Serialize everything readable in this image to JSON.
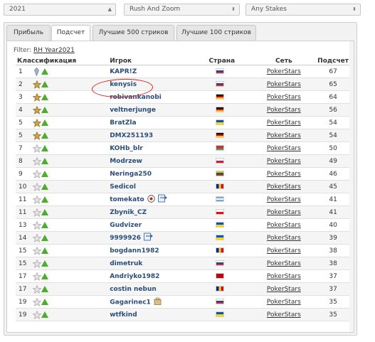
{
  "filters": {
    "year": "2021",
    "game": "Rush And Zoom",
    "stakes": "Any Stakes"
  },
  "tabs": [
    "Прибыль",
    "Подсчет",
    "Лучшие 500 стриков",
    "Лучшие 100 стриков"
  ],
  "active_tab": "Подсчет",
  "filter_label": "Filter:",
  "filter_value": "RH Year2021",
  "columns": {
    "rank": "Классификация",
    "player": "Игрок",
    "country": "Страна",
    "network": "Сеть",
    "count": "Подсчет"
  },
  "rows": [
    {
      "rank": "1",
      "badge": "diamond",
      "player": "KAPR!Z",
      "flag": "ru",
      "network": "PokerStars",
      "count": "67"
    },
    {
      "rank": "2",
      "badge": "gold",
      "player": "kenysis",
      "flag": "ru",
      "network": "PokerStars",
      "count": "65"
    },
    {
      "rank": "3",
      "badge": "gold",
      "player": "robivankanobi",
      "flag": "de",
      "network": "PokerStars",
      "count": "64"
    },
    {
      "rank": "4",
      "badge": "gold",
      "player": "veltnerjunge",
      "flag": "de",
      "network": "PokerStars",
      "count": "56"
    },
    {
      "rank": "5",
      "badge": "gold",
      "player": "BratZla",
      "flag": "ua",
      "network": "PokerStars",
      "count": "54"
    },
    {
      "rank": "5",
      "badge": "gold",
      "player": "DMX251193",
      "flag": "de",
      "network": "PokerStars",
      "count": "54"
    },
    {
      "rank": "7",
      "badge": "silver",
      "player": "KOHb_blr",
      "flag": "by",
      "network": "PokerStars",
      "count": "50"
    },
    {
      "rank": "8",
      "badge": "silver",
      "player": "Modrzew",
      "flag": "pl",
      "network": "PokerStars",
      "count": "49"
    },
    {
      "rank": "9",
      "badge": "silver",
      "player": "Neringa250",
      "flag": "lt",
      "network": "PokerStars",
      "count": "46"
    },
    {
      "rank": "10",
      "badge": "silver",
      "player": "Sedicol",
      "flag": "ro",
      "network": "PokerStars",
      "count": "45"
    },
    {
      "rank": "11",
      "badge": "silver",
      "player": "tomekato",
      "flag": "ar",
      "network": "PokerStars",
      "count": "41",
      "icons": [
        "target",
        "export"
      ]
    },
    {
      "rank": "11",
      "badge": "silver",
      "player": "Zbynik_CZ",
      "flag": "cz",
      "network": "PokerStars",
      "count": "41"
    },
    {
      "rank": "13",
      "badge": "silver",
      "player": "Gudvizer",
      "flag": "ua",
      "network": "PokerStars",
      "count": "40"
    },
    {
      "rank": "14",
      "badge": "silver",
      "player": "9999926",
      "flag": "ua",
      "network": "PokerStars",
      "count": "39",
      "icons": [
        "export"
      ]
    },
    {
      "rank": "15",
      "badge": "silver",
      "player": "bogdann1982",
      "flag": "ro",
      "network": "PokerStars",
      "count": "38"
    },
    {
      "rank": "15",
      "badge": "silver",
      "player": "dimetruk",
      "flag": "ru",
      "network": "PokerStars",
      "count": "38"
    },
    {
      "rank": "17",
      "badge": "silver",
      "player": "Andriyko1982",
      "flag": "me",
      "network": "PokerStars",
      "count": "37"
    },
    {
      "rank": "17",
      "badge": "silver",
      "player": "costin nebun",
      "flag": "ro",
      "network": "PokerStars",
      "count": "37"
    },
    {
      "rank": "19",
      "badge": "silver",
      "player": "Gagarinec1",
      "flag": "ru",
      "network": "PokerStars",
      "count": "35",
      "icons": [
        "bag"
      ]
    },
    {
      "rank": "19",
      "badge": "silver",
      "player": "wtfkind",
      "flag": "ua",
      "network": "PokerStars",
      "count": "35"
    }
  ],
  "colors": {
    "rank_up": "#4caf2c",
    "player_text": "#2a4d7a",
    "annotation": "#e0201c"
  }
}
